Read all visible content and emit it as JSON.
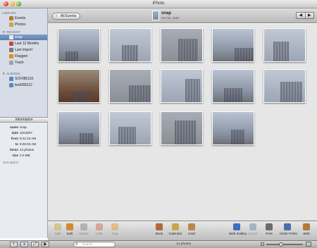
{
  "window": {
    "title": "iPhoto"
  },
  "sidebar": {
    "library_heading": "LIBRARY",
    "library_items": [
      {
        "label": "Events",
        "icon": "events-icon",
        "color": "#b8792e"
      },
      {
        "label": "Photos",
        "icon": "photos-icon",
        "color": "#c9a24a"
      }
    ],
    "recent_heading": "RECENT",
    "recent_items": [
      {
        "label": "snap",
        "icon": "event-icon",
        "color": "#e4e8ef",
        "selected": true
      },
      {
        "label": "Last 12 Months",
        "icon": "calendar-icon",
        "color": "#c54a3b"
      },
      {
        "label": "Last Import",
        "icon": "import-icon",
        "color": "#7a7a7a"
      },
      {
        "label": "Flagged",
        "icon": "flag-icon",
        "color": "#e38a1c"
      },
      {
        "label": "Trash",
        "icon": "trash-icon",
        "color": "#9aa2ab"
      }
    ],
    "albums_heading": "ALBUMS",
    "album_items": [
      {
        "label": "SCF080110",
        "icon": "album-icon",
        "color": "#5f86bf"
      },
      {
        "label": "test090212",
        "icon": "album-icon",
        "color": "#5f86bf"
      }
    ]
  },
  "info": {
    "title": "Information",
    "rows": [
      {
        "key": "name",
        "value": "snap"
      },
      {
        "key": "date",
        "value": "10/18/07"
      },
      {
        "key": "from",
        "value": "9:21:24 AM"
      },
      {
        "key": "to",
        "value": "9:26:02 AM"
      },
      {
        "key": "items",
        "value": "14 photos"
      },
      {
        "key": "size",
        "value": "2.0 MB"
      }
    ],
    "description_placeholder": "description"
  },
  "topbar": {
    "back_label": "All Events",
    "event_name": "snap",
    "event_date": "Oct 18, 2007",
    "prev_glyph": "◀",
    "next_glyph": "▶"
  },
  "photos": [
    {
      "name": "photo-1",
      "tone": "sky1"
    },
    {
      "name": "photo-2",
      "tone": "sky2"
    },
    {
      "name": "photo-3",
      "tone": "sky3"
    },
    {
      "name": "photo-4",
      "tone": "sky1"
    },
    {
      "name": "photo-5",
      "tone": "sky2"
    },
    {
      "name": "photo-6",
      "tone": "rust"
    },
    {
      "name": "photo-7",
      "tone": "sky3"
    },
    {
      "name": "photo-8",
      "tone": "sky2"
    },
    {
      "name": "photo-9",
      "tone": "sky1"
    },
    {
      "name": "photo-10",
      "tone": "sky2"
    },
    {
      "name": "photo-11",
      "tone": "sky1"
    },
    {
      "name": "photo-12",
      "tone": "sky2"
    },
    {
      "name": "photo-13",
      "tone": "sky3"
    },
    {
      "name": "photo-14",
      "tone": "sky1"
    }
  ],
  "toolbar": {
    "left_tools": [
      {
        "label": "Split",
        "icon": "split-icon",
        "color": "#c7b34a",
        "dim": true
      },
      {
        "label": "Edit",
        "icon": "edit-icon",
        "color": "#d38a2a",
        "dim": false
      },
      {
        "label": "Rotate",
        "icon": "rotate-icon",
        "color": "#8f8f8f",
        "dim": true
      },
      {
        "label": "Hide",
        "icon": "hide-icon",
        "color": "#c97a6a",
        "dim": true
      },
      {
        "label": "Flag",
        "icon": "flag-icon",
        "color": "#e3a24a",
        "dim": true
      }
    ],
    "mid_tools": [
      {
        "label": "Book",
        "icon": "book-icon",
        "color": "#b06a3a"
      },
      {
        "label": "Calendar",
        "icon": "calendar-icon",
        "color": "#c9a64a"
      },
      {
        "label": "Card",
        "icon": "card-icon",
        "color": "#b88a4a"
      }
    ],
    "right_tools": [
      {
        "label": "Web Gallery",
        "icon": "web-gallery-icon",
        "color": "#3b6fc4",
        "dim": false
      },
      {
        "label": "Email",
        "icon": "email-icon",
        "color": "#7a8fb0",
        "dim": true
      },
      {
        "label": "Print",
        "icon": "print-icon",
        "color": "#6b6b6b",
        "dim": false
      },
      {
        "label": "Order Prints",
        "icon": "order-prints-icon",
        "color": "#4a6fa8",
        "dim": false
      },
      {
        "label": "Web",
        "icon": "web-icon",
        "color": "#b07a3a",
        "dim": false
      }
    ]
  },
  "statusbar": {
    "search_placeholder": "Search",
    "count_text": "14 photos",
    "zoom_level": 0.4
  }
}
